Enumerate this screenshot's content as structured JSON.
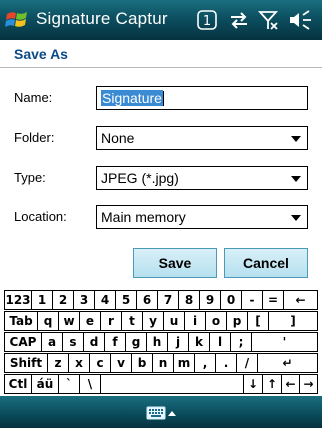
{
  "titlebar": {
    "title": "Signature Captur",
    "icons": [
      "windows-logo",
      "notification-one-icon",
      "sync-icon",
      "signal-off-icon",
      "volume-icon"
    ]
  },
  "section": {
    "title": "Save As"
  },
  "form": {
    "name_label": "Name:",
    "name_value": "Signature",
    "folder_label": "Folder:",
    "folder_value": "None",
    "type_label": "Type:",
    "type_value": "JPEG (*.jpg)",
    "location_label": "Location:",
    "location_value": "Main memory"
  },
  "buttons": {
    "save": "Save",
    "cancel": "Cancel"
  },
  "keyboard": {
    "row1": [
      "123",
      "1",
      "2",
      "3",
      "4",
      "5",
      "6",
      "7",
      "8",
      "9",
      "0",
      "-",
      "=",
      "←"
    ],
    "row2": [
      "Tab",
      "q",
      "w",
      "e",
      "r",
      "t",
      "y",
      "u",
      "i",
      "o",
      "p",
      "[",
      "]"
    ],
    "row3": [
      "CAP",
      "a",
      "s",
      "d",
      "f",
      "g",
      "h",
      "j",
      "k",
      "l",
      ";",
      "'"
    ],
    "row4": [
      "Shift",
      "z",
      "x",
      "c",
      "v",
      "b",
      "n",
      "m",
      ",",
      ".",
      "/",
      "↵"
    ],
    "row5": [
      "Ctl",
      "áü",
      "`",
      "\\",
      "",
      "↓",
      "↑",
      "←",
      "→"
    ]
  },
  "colors": {
    "bar": "#0c4f60",
    "accent": "#0b4a86",
    "selection": "#3a8ad4"
  }
}
